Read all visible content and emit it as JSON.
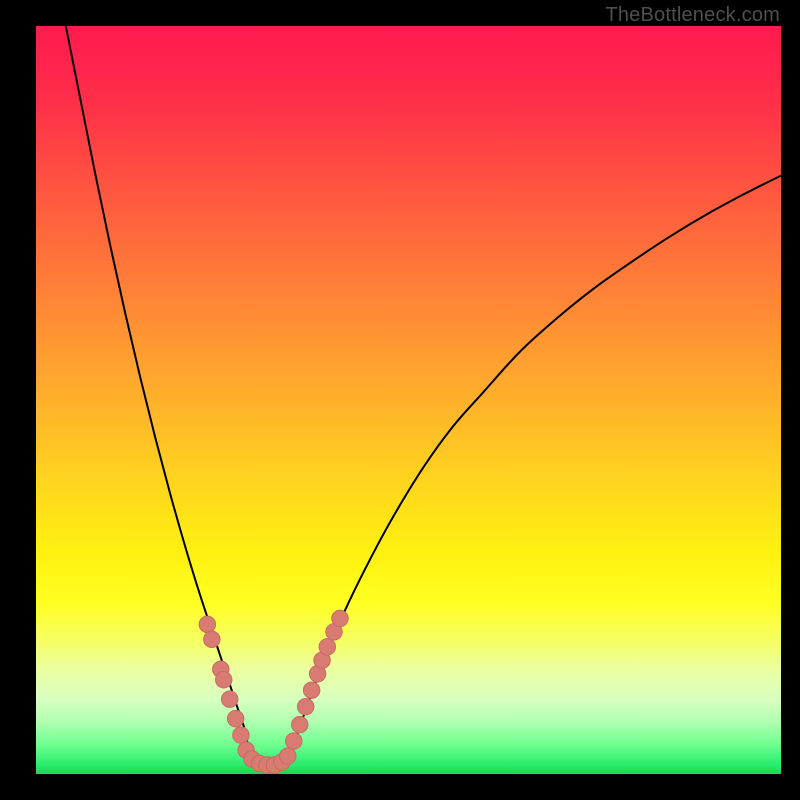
{
  "watermark": "TheBottleneck.com",
  "colors": {
    "frame": "#000000",
    "curve": "#000000",
    "dot_fill": "#d77b73",
    "dot_stroke": "#c96a63",
    "gradient_stops": [
      {
        "offset": 0.0,
        "color": "#ff1a4f"
      },
      {
        "offset": 0.1,
        "color": "#ff2e49"
      },
      {
        "offset": 0.22,
        "color": "#ff5640"
      },
      {
        "offset": 0.35,
        "color": "#ff8037"
      },
      {
        "offset": 0.48,
        "color": "#ffaa2d"
      },
      {
        "offset": 0.6,
        "color": "#ffd21f"
      },
      {
        "offset": 0.7,
        "color": "#fff010"
      },
      {
        "offset": 0.77,
        "color": "#ffff20"
      },
      {
        "offset": 0.82,
        "color": "#f6ff60"
      },
      {
        "offset": 0.86,
        "color": "#ecffa0"
      },
      {
        "offset": 0.9,
        "color": "#d8ffc0"
      },
      {
        "offset": 0.93,
        "color": "#b0ffb0"
      },
      {
        "offset": 0.96,
        "color": "#70ff90"
      },
      {
        "offset": 0.985,
        "color": "#30ef70"
      },
      {
        "offset": 1.0,
        "color": "#18d858"
      }
    ]
  },
  "chart_data": {
    "type": "line",
    "title": "",
    "xlabel": "",
    "ylabel": "",
    "xlim": [
      0,
      100
    ],
    "ylim": [
      0,
      100
    ],
    "grid": false,
    "series": [
      {
        "name": "left-branch",
        "x": [
          4,
          6,
          8,
          10,
          12,
          14,
          16,
          18,
          20,
          22,
          24,
          25,
          26,
          27,
          28,
          28.8
        ],
        "y": [
          100,
          90,
          80,
          70.5,
          61.5,
          53,
          45,
          37.5,
          30.5,
          24,
          18,
          15,
          12,
          9,
          6,
          2.5
        ]
      },
      {
        "name": "valley",
        "x": [
          28.8,
          30,
          31,
          32,
          33,
          34
        ],
        "y": [
          2.5,
          1.4,
          1.2,
          1.2,
          1.4,
          2.5
        ]
      },
      {
        "name": "right-branch",
        "x": [
          34,
          36,
          38,
          40,
          42,
          45,
          48,
          52,
          56,
          60,
          65,
          70,
          75,
          80,
          85,
          90,
          95,
          100
        ],
        "y": [
          2.5,
          8,
          13.5,
          18.5,
          23,
          29,
          34.5,
          41,
          46.5,
          51,
          56.5,
          61,
          65,
          68.5,
          71.8,
          74.8,
          77.5,
          80
        ]
      }
    ],
    "dots": {
      "name": "highlight-dots",
      "points": [
        {
          "x": 23.0,
          "y": 20.0
        },
        {
          "x": 23.6,
          "y": 18.0
        },
        {
          "x": 24.8,
          "y": 14.0
        },
        {
          "x": 25.2,
          "y": 12.6
        },
        {
          "x": 26.0,
          "y": 10.0
        },
        {
          "x": 26.8,
          "y": 7.4
        },
        {
          "x": 27.5,
          "y": 5.2
        },
        {
          "x": 28.2,
          "y": 3.2
        },
        {
          "x": 29.0,
          "y": 2.0
        },
        {
          "x": 30.0,
          "y": 1.4
        },
        {
          "x": 31.0,
          "y": 1.2
        },
        {
          "x": 32.0,
          "y": 1.2
        },
        {
          "x": 33.0,
          "y": 1.6
        },
        {
          "x": 33.8,
          "y": 2.4
        },
        {
          "x": 34.6,
          "y": 4.4
        },
        {
          "x": 35.4,
          "y": 6.6
        },
        {
          "x": 36.2,
          "y": 9.0
        },
        {
          "x": 37.0,
          "y": 11.2
        },
        {
          "x": 37.8,
          "y": 13.4
        },
        {
          "x": 38.4,
          "y": 15.2
        },
        {
          "x": 39.1,
          "y": 17.0
        },
        {
          "x": 40.0,
          "y": 19.0
        },
        {
          "x": 40.8,
          "y": 20.8
        }
      ],
      "radius_y": 1.1
    }
  }
}
